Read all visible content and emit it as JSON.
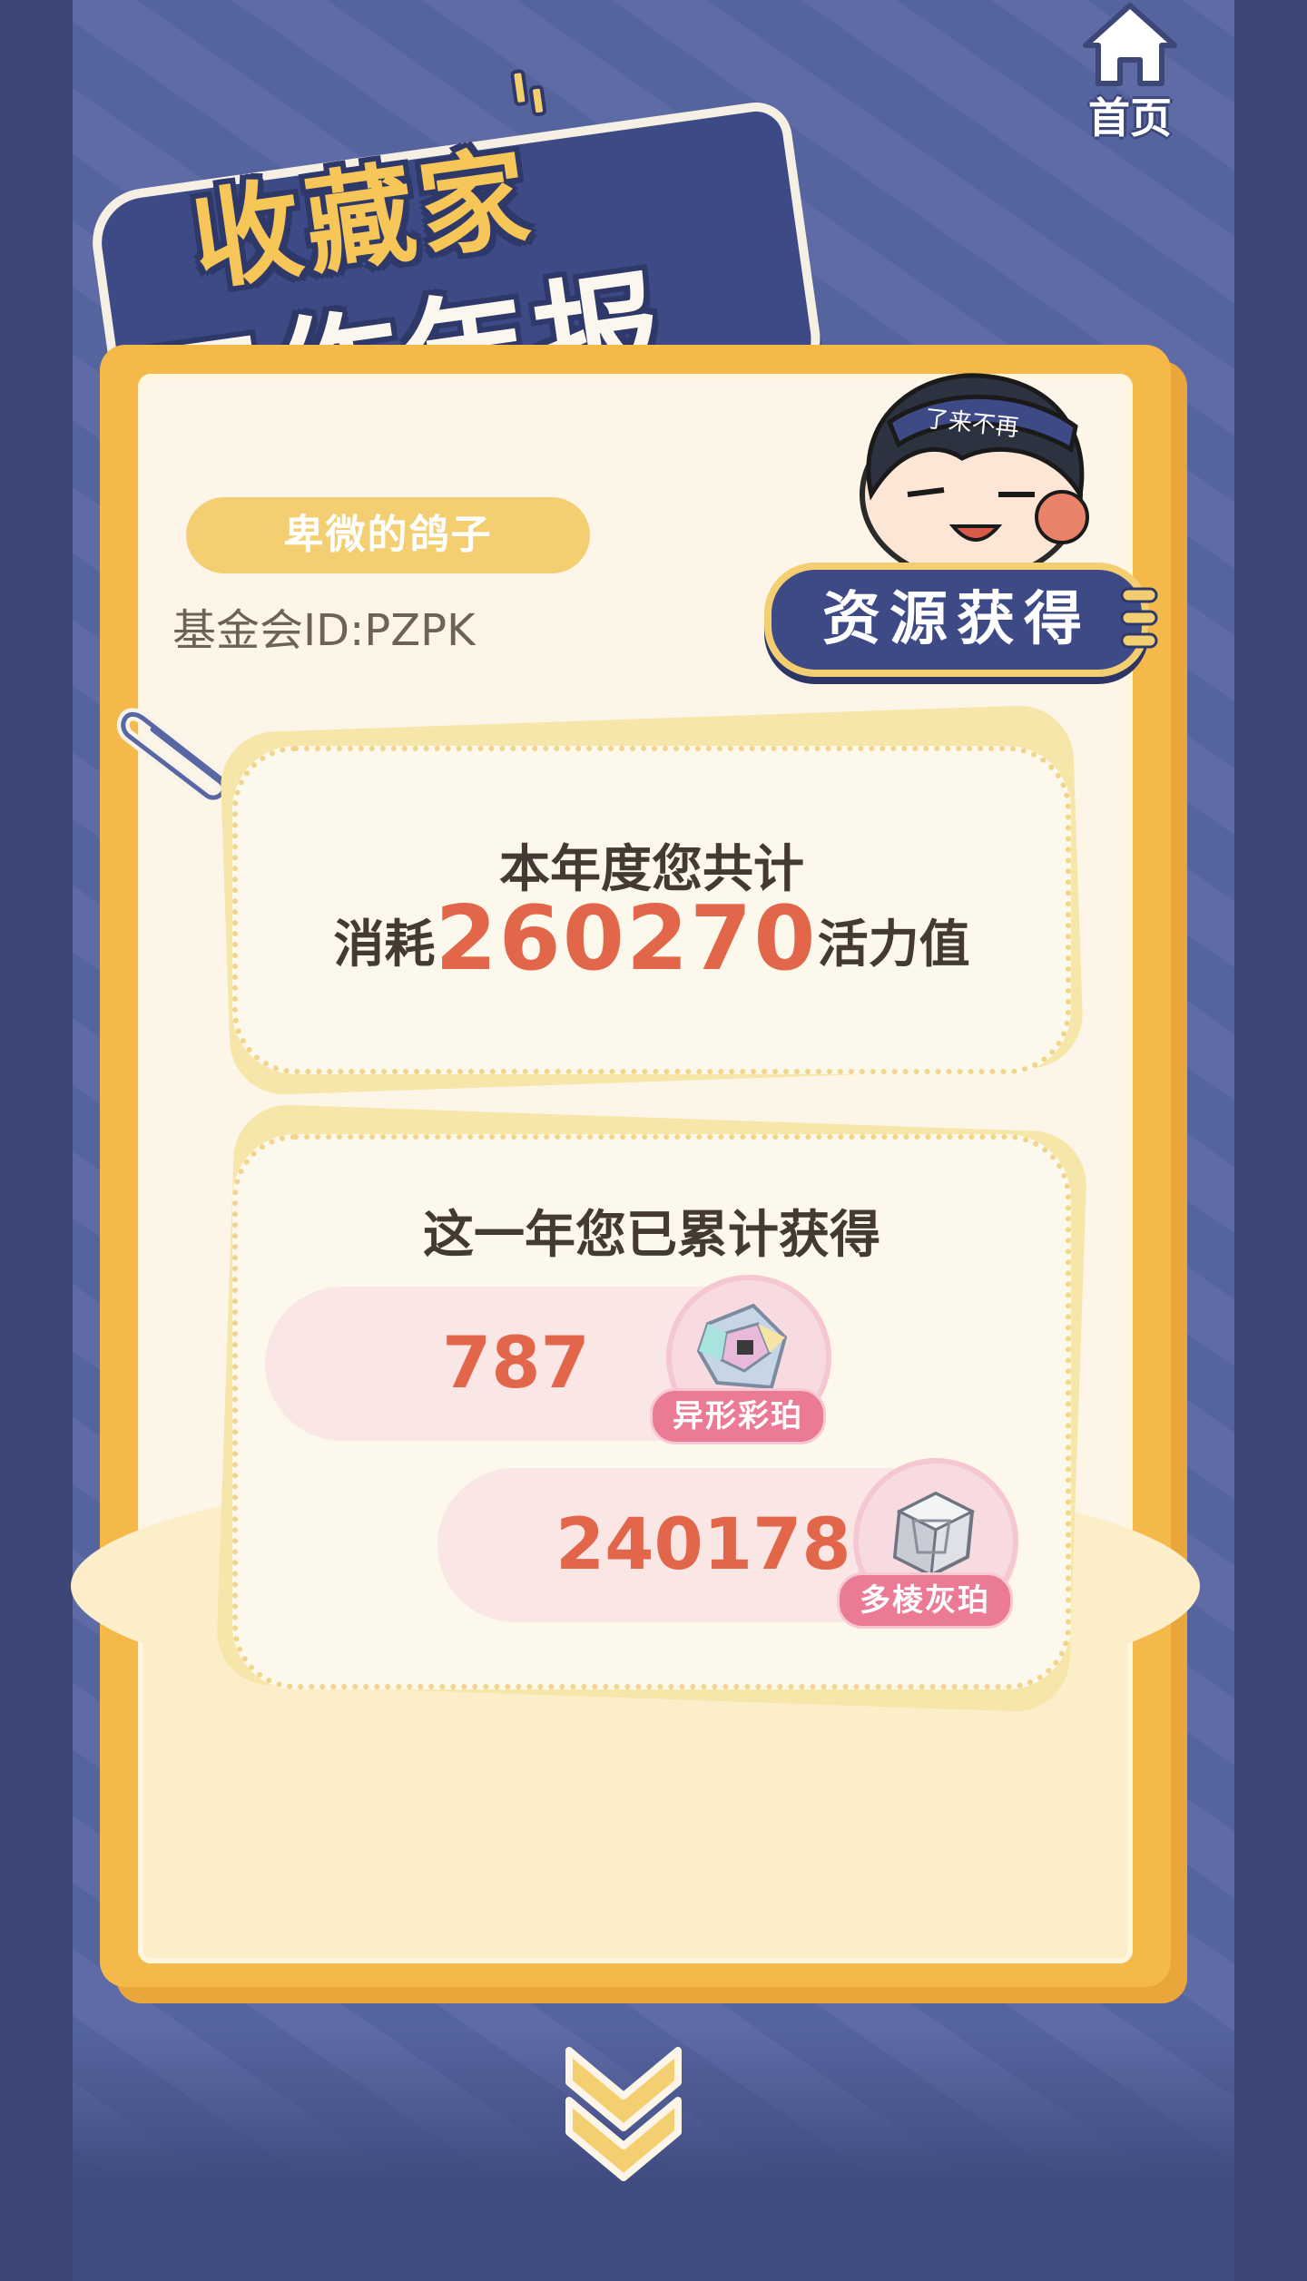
{
  "nav": {
    "home_label": "首页"
  },
  "title": {
    "line1": "收藏家",
    "line2": "工作年报"
  },
  "user": {
    "name": "卑微的鸽子",
    "id_text": "基金会ID:PZPK"
  },
  "badge": {
    "label": "资源获得",
    "hat_text": "了来不再"
  },
  "consumption": {
    "line1": "本年度您共计",
    "prefix": "消耗",
    "value": "260270",
    "suffix": "活力值"
  },
  "gains": {
    "title": "这一年您已累计获得",
    "items": [
      {
        "value": "787",
        "label": "异形彩珀",
        "icon": "iridescent-amber-icon"
      },
      {
        "value": "240178",
        "label": "多棱灰珀",
        "icon": "prismatic-grey-amber-icon"
      }
    ]
  },
  "colors": {
    "background": "#5866a3",
    "card": "#f4b948",
    "accent_number": "#e2664a",
    "badge": "#3e4a85",
    "label_pink": "#eb7a95"
  }
}
